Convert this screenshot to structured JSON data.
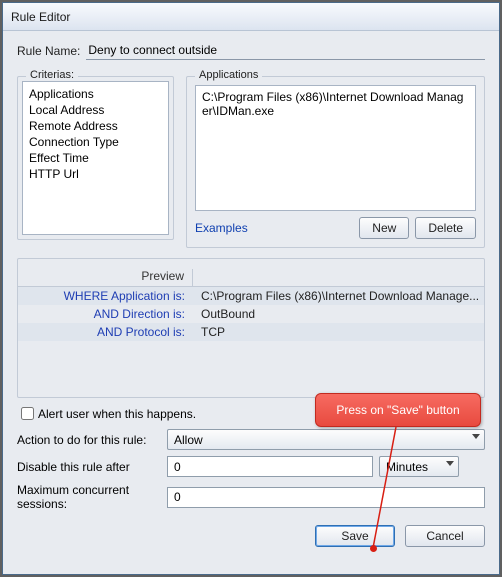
{
  "titlebar": "Rule Editor",
  "ruleNameLabel": "Rule Name:",
  "ruleNameValue": "Deny to connect outside",
  "criteriasLegend": "Criterias:",
  "criterias": [
    "Applications",
    "Local Address",
    "Remote Address",
    "Connection Type",
    "Effect Time",
    "HTTP Url"
  ],
  "appsLegend": "Applications",
  "appsPath": "C:\\Program Files (x86)\\Internet Download Manager\\IDMan.exe",
  "examplesLink": "Examples",
  "newBtn": "New",
  "deleteBtn": "Delete",
  "previewLabel": "Preview",
  "preview": [
    {
      "k": "WHERE Application is:",
      "v": "C:\\Program Files (x86)\\Internet Download Manage..."
    },
    {
      "k": "AND Direction is:",
      "v": "OutBound"
    },
    {
      "k": "AND Protocol is:",
      "v": "TCP"
    }
  ],
  "alertLabel": "Alert user when this happens.",
  "actionLabel": "Action to do for this rule:",
  "actionValue": "Allow",
  "disableLabel": "Disable this rule after",
  "disableValue": "0",
  "disableUnit": "Minutes",
  "maxSessLabel": "Maximum concurrent sessions:",
  "maxSessValue": "0",
  "saveBtn": "Save",
  "cancelBtn": "Cancel",
  "callout": "Press on \"Save\" button"
}
